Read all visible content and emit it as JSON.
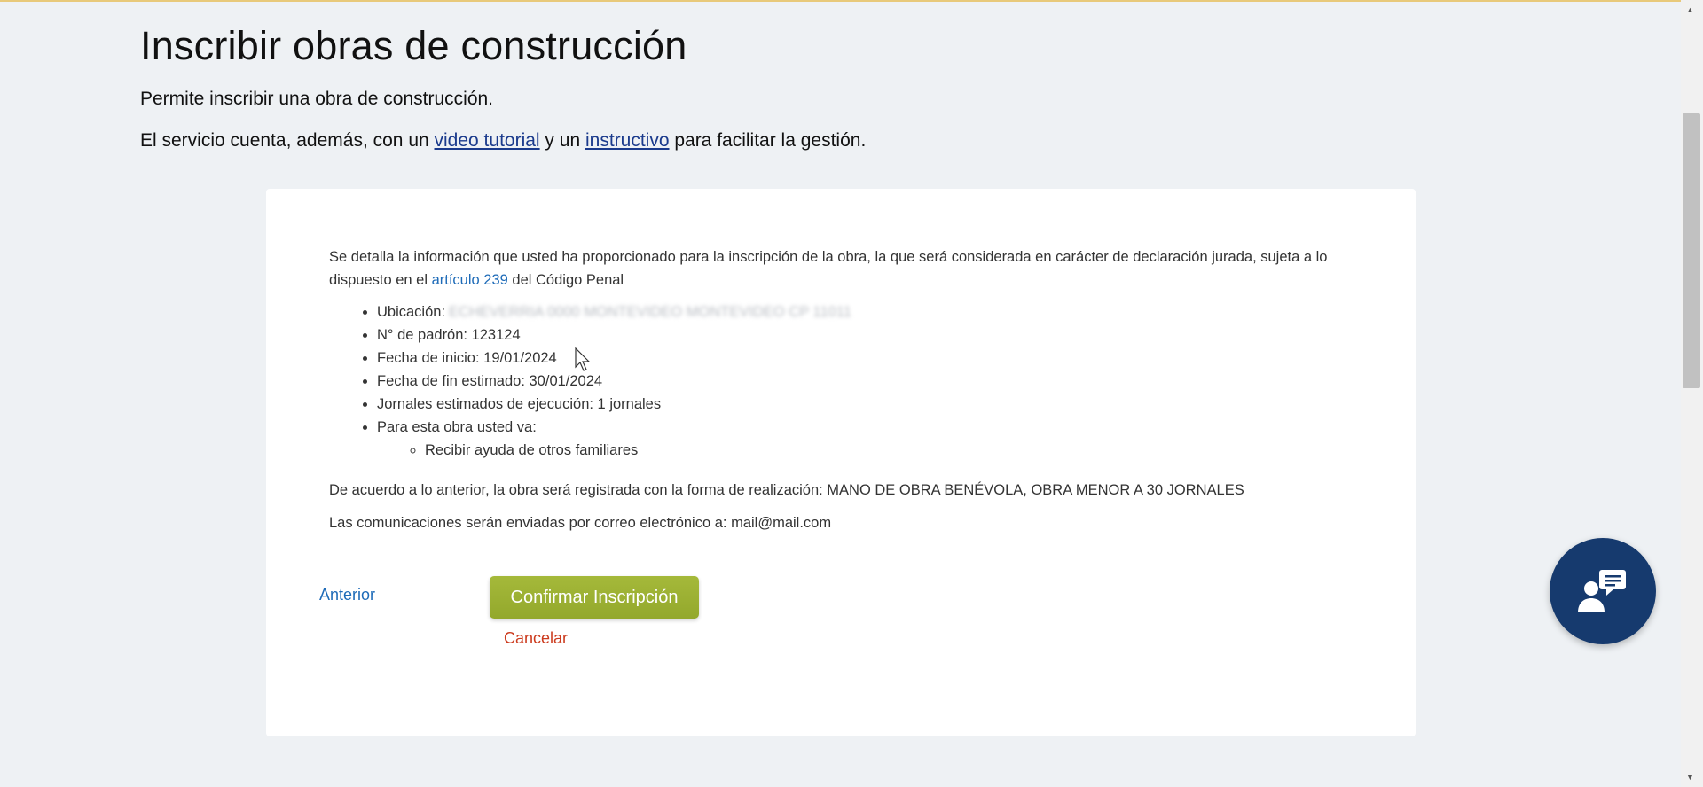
{
  "header": {
    "title": "Inscribir obras de construcción",
    "subtitle": "Permite inscribir una obra de construcción.",
    "service_prefix": "El servicio cuenta, además, con un ",
    "video_link": "video tutorial",
    "service_mid": " y un ",
    "instructivo_link": "instructivo",
    "service_suffix": " para facilitar la gestión."
  },
  "summary": {
    "description_prefix": "Se detalla la información que usted ha proporcionado para la inscripción de la obra, la que será considerada en carácter de declaración jurada, sujeta a lo dispuesto en el ",
    "article_link": "artículo 239",
    "description_suffix": " del Código Penal",
    "items": {
      "ubicacion_label": "Ubicación:",
      "ubicacion_value": "ECHEVERRIA 0000 MONTEVIDEO MONTEVIDEO CP 11011",
      "padron": "N° de padrón: 123124",
      "fecha_inicio": "Fecha de inicio: 19/01/2024",
      "fecha_fin": "Fecha de fin estimado: 30/01/2024",
      "jornales": "Jornales estimados de ejecución: 1 jornales",
      "para_obra": "Para esta obra usted va:",
      "sub_item": "Recibir ayuda de otros familiares"
    },
    "forma": "De acuerdo a lo anterior, la obra será registrada con la forma de realización: MANO DE OBRA BENÉVOLA, OBRA MENOR A 30 JORNALES",
    "mail": "Las comunicaciones serán enviadas por correo electrónico a: mail@mail.com"
  },
  "actions": {
    "previous": "Anterior",
    "confirm": "Confirmar Inscripción",
    "cancel": "Cancelar"
  },
  "icons": {
    "chat": "chat-support-icon",
    "cursor": "mouse-cursor-icon"
  },
  "colors": {
    "background": "#eef1f4",
    "link": "#1e6bb8",
    "confirm_button": "#9db235",
    "cancel": "#cc3b1e",
    "chat_fab": "#163a6e"
  }
}
